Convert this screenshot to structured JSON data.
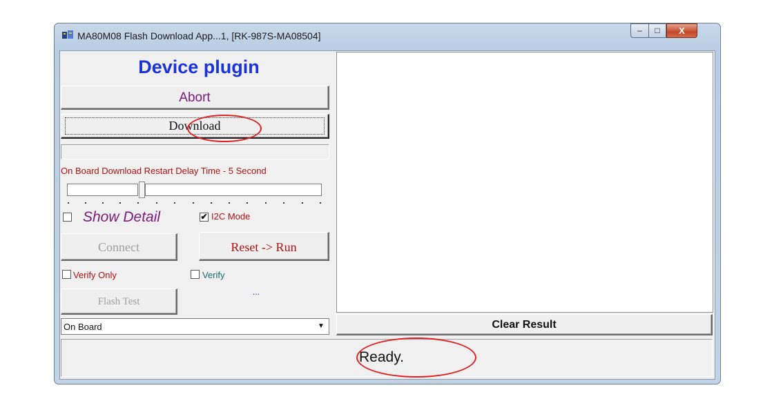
{
  "window": {
    "title": "MA80M08 Flash Download App...1, [RK-987S-MA08504]",
    "minimize_glyph": "–",
    "maximize_glyph": "□",
    "close_glyph": "X"
  },
  "left_panel": {
    "heading": "Device plugin",
    "abort_label": "Abort",
    "download_label": "Download",
    "delay_label": "On Board Download Restart Delay Time - 5 Second",
    "show_detail_label": "Show Detail",
    "show_detail_checked": false,
    "i2c_mode_label": "I2C Mode",
    "i2c_mode_checked": true,
    "connect_label": "Connect",
    "reset_run_label": "Reset -> Run",
    "verify_only_label": "Verify Only",
    "verify_label": "Verify",
    "ellipsis_text": "...",
    "flash_test_label": "Flash Test",
    "dropdown_value": "On Board"
  },
  "right_panel": {
    "clear_result_label": "Clear Result"
  },
  "status": {
    "text": "Ready."
  },
  "icons": [
    "app-icon",
    "minimize-icon",
    "maximize-icon",
    "close-icon",
    "dropdown-arrow-icon",
    "checkmark-icon"
  ],
  "colors": {
    "heading": "#1a33d6",
    "accent_purple": "#7a1a7a",
    "accent_red": "#b01010",
    "annotation": "#e02020"
  }
}
